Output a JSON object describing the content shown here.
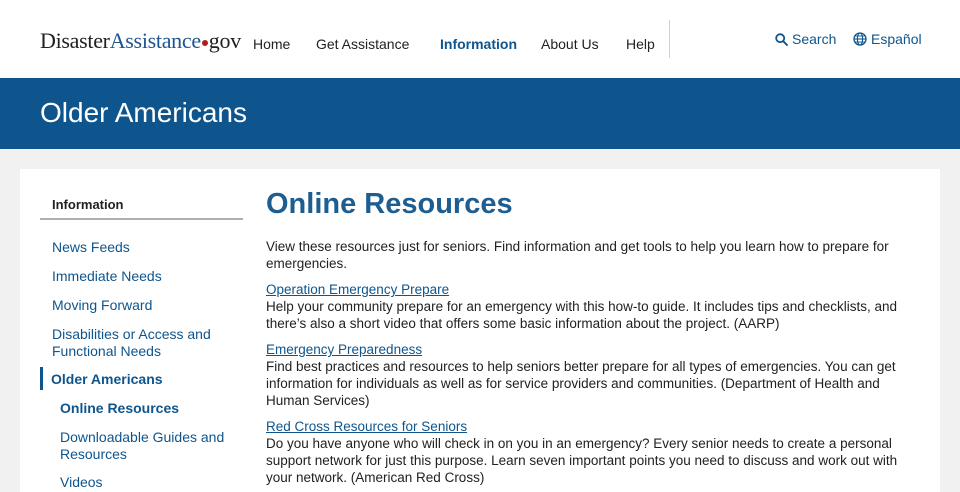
{
  "header": {
    "logo": {
      "part1": "Disaster",
      "part2": "Assistance",
      "part3": "gov"
    },
    "nav": [
      {
        "label": "Home",
        "active": false
      },
      {
        "label": "Get Assistance",
        "active": false
      },
      {
        "label": "Information",
        "active": true
      },
      {
        "label": "About Us",
        "active": false
      },
      {
        "label": "Help",
        "active": false
      }
    ],
    "search_label": "Search",
    "language_label": "Español"
  },
  "banner": {
    "title": "Older Americans"
  },
  "sidebar": {
    "heading": "Information",
    "items": [
      {
        "label": "News Feeds"
      },
      {
        "label": "Immediate Needs"
      },
      {
        "label": "Moving Forward"
      },
      {
        "label": "Disabilities or Access and Functional Needs"
      },
      {
        "label": "Older Americans",
        "current": true
      },
      {
        "label": "Online Resources",
        "sub": true,
        "current": true
      },
      {
        "label": "Downloadable Guides and Resources",
        "sub": true
      },
      {
        "label": "Videos",
        "sub": true
      }
    ]
  },
  "main": {
    "title": "Online Resources",
    "intro": "View these resources just for seniors. Find information and get tools to help you learn how to prepare for emergencies.",
    "resources": [
      {
        "link": "Operation Emergency Prepare",
        "description": "Help your community prepare for an emergency with this how-to guide. It includes tips and checklists, and there’s also a short video that offers some basic information about the project. (AARP)"
      },
      {
        "link": "Emergency Preparedness",
        "description": "Find best practices and resources to help seniors better prepare for all types of emergencies. You can get information for individuals as well as for service providers and communities. (Department of Health and Human Services)"
      },
      {
        "link": "Red Cross Resources for Seniors",
        "description": "Do you have anyone who will check in on you in an emergency? Every senior needs to create a personal support network for just this purpose. Learn seven important points you need to discuss and work out with your network. (American Red Cross)"
      }
    ]
  },
  "colors": {
    "brand_blue": "#0e558d",
    "title_blue": "#1d5d90",
    "logo_dot": "#b31b1b"
  }
}
